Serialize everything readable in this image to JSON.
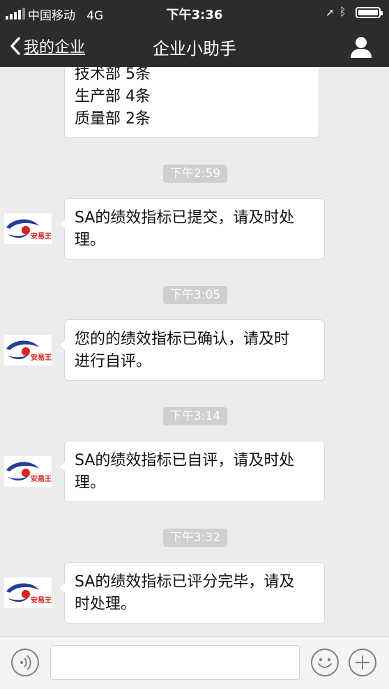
{
  "status_bar": {
    "carrier": "中国移动",
    "network": "4G",
    "time": "下午3:36"
  },
  "nav": {
    "back_label": "我的企业",
    "title": "企业小助手"
  },
  "partial_message": {
    "lines": [
      "技术部 5条",
      "生产部 4条",
      "质量部 2条"
    ]
  },
  "messages": [
    {
      "timestamp": "下午2:59",
      "lines": [
        "SA的绩效指标已提交，请及时处",
        "理。"
      ]
    },
    {
      "timestamp": "下午3:05",
      "lines": [
        "您的的绩效指标已确认，请及时",
        "进行自评。"
      ]
    },
    {
      "timestamp": "下午3:14",
      "lines": [
        "SA的绩效指标已自评，请及时处",
        "理。"
      ]
    },
    {
      "timestamp": "下午3:32",
      "lines": [
        "SA的绩效指标已评分完毕，请及",
        "时处理。"
      ]
    }
  ],
  "avatar_logo_text": "安易王",
  "colors": {
    "header_bg": "#2c2c2c",
    "chat_bg": "#ececec",
    "bubble_bg": "#ffffff",
    "timestamp_bg": "#cfcfcf",
    "logo_blue": "#1f3f9a",
    "logo_red": "#e0201e"
  },
  "icons": {
    "back": "chevron-left-icon",
    "profile": "person-icon",
    "voice": "voice-icon",
    "emoji": "smiley-icon",
    "more": "plus-icon"
  }
}
